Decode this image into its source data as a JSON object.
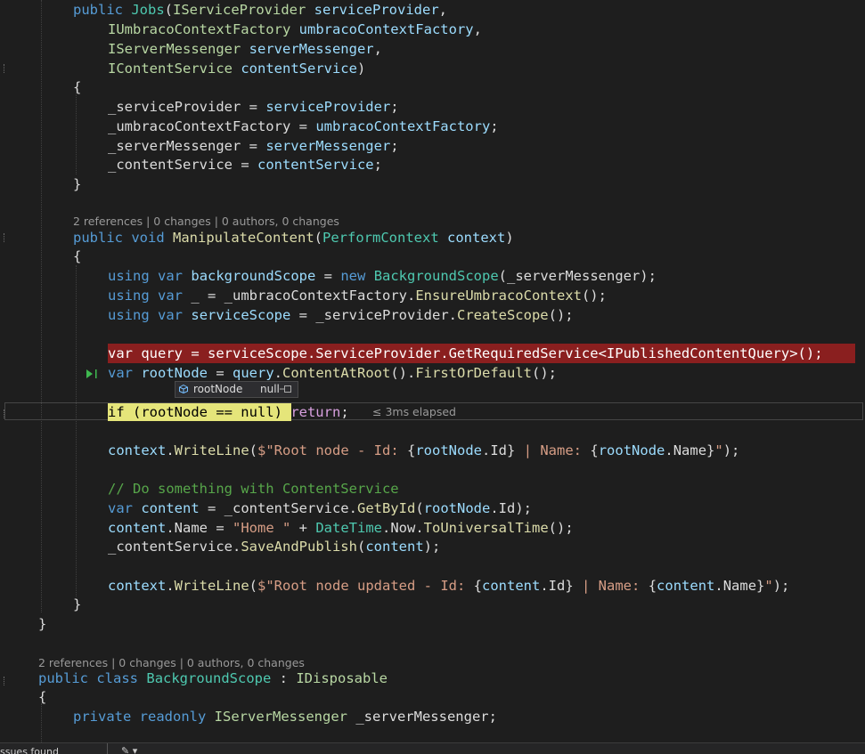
{
  "code": {
    "ctor_line_1": {
      "kw": "public",
      "name": "Jobs",
      "open": "(",
      "type": "IServiceProvider",
      "param": "serviceProvider",
      "end": ","
    },
    "ctor_line_2": {
      "type": "IUmbracoContextFactory",
      "param": "umbracoContextFactory",
      "end": ","
    },
    "ctor_line_3": {
      "type": "IServerMessenger",
      "param": "serverMessenger",
      "end": ","
    },
    "ctor_line_4": {
      "type": "IContentService",
      "param": "contentService",
      "end": ")"
    },
    "open_brace": "{",
    "close_brace": "}",
    "assign_1": {
      "field": "_serviceProvider",
      "op": " = ",
      "value": "serviceProvider",
      "end": ";"
    },
    "assign_2": {
      "field": "_umbracoContextFactory",
      "op": " = ",
      "value": "umbracoContextFactory",
      "end": ";"
    },
    "assign_3": {
      "field": "_serverMessenger",
      "op": " = ",
      "value": "serverMessenger",
      "end": ";"
    },
    "assign_4": {
      "field": "_contentService",
      "op": " = ",
      "value": "contentService",
      "end": ";"
    },
    "lens_manipulate": "2 references | 0 changes | 0 authors, 0 changes",
    "method_sig": {
      "kw1": "public",
      "kw2": "void",
      "name": "ManipulateContent",
      "open": "(",
      "type": "PerformContext",
      "param": "context",
      "close": ")"
    },
    "using_1": {
      "kw1": "using",
      "kw2": "var",
      "var": "backgroundScope",
      "eq": " = ",
      "new": "new",
      "type": "BackgroundScope",
      "args": "(_serverMessenger);"
    },
    "using_2": {
      "kw1": "using",
      "kw2": "var",
      "rest": "_ = _umbracoContextFactory.",
      "fn": "EnsureUmbracoContext",
      "end": "();"
    },
    "using_3": {
      "kw1": "using",
      "kw2": "var",
      "var": "serviceScope",
      "eq": " = _serviceProvider.",
      "fn": "CreateScope",
      "end": "();"
    },
    "query_line": "var query = serviceScope.ServiceProvider.GetRequiredService<IPublishedContentQuery>();",
    "rootnode_line": {
      "kw": "var",
      "var": "rootNode",
      "eq": " = ",
      "obj": "query",
      "dot1": ".",
      "fn1": "ContentAtRoot",
      "mid": "().",
      "fn2": "FirstOrDefault",
      "end": "();"
    },
    "datatip": {
      "name": "rootNode",
      "value": "null"
    },
    "if_line": {
      "stmt": "if (rootNode == null)",
      "ret": "return",
      "end": ";"
    },
    "elapsed": "≤ 3ms elapsed",
    "writeline_1": {
      "obj": "context",
      "dot": ".",
      "fn": "WriteLine",
      "open": "(",
      "s1": "$\"Root node - Id: ",
      "b1": "{",
      "v1": "rootNode",
      "d1": ".",
      "p1": "Id",
      "c1": "}",
      "s2": " | Name: ",
      "b2": "{",
      "v2": "rootNode",
      "d2": ".",
      "p2": "Name",
      "c2": "}",
      "s3": "\"",
      "end": ");"
    },
    "comment": "// Do something with ContentService",
    "content_1": {
      "kw": "var",
      "var": "content",
      "eq": " = _contentService.",
      "fn": "GetById",
      "open": "(",
      "arg": "rootNode",
      "dot": ".",
      "prop": "Id",
      "end": ");"
    },
    "content_2": {
      "var": "content",
      "dot": ".",
      "prop": "Name",
      "eq": " = ",
      "str": "\"Home \"",
      "plus": " + ",
      "type": "DateTime",
      "d1": ".",
      "now": "Now",
      "d2": ".",
      "fn": "ToUniversalTime",
      "end": "();"
    },
    "content_3": {
      "obj": "_contentService",
      "dot": ".",
      "fn": "SaveAndPublish",
      "open": "(",
      "arg": "content",
      "end": ");"
    },
    "writeline_2": {
      "obj": "context",
      "dot": ".",
      "fn": "WriteLine",
      "open": "(",
      "s1": "$\"Root node updated - Id: ",
      "b1": "{",
      "v1": "content",
      "d1": ".",
      "p1": "Id",
      "c1": "}",
      "s2": " | Name: ",
      "b2": "{",
      "v2": "content",
      "d2": ".",
      "p2": "Name",
      "c2": "}",
      "s3": "\"",
      "end": ");"
    },
    "lens_background": "2 references | 0 changes | 0 authors, 0 changes",
    "class_decl": {
      "kw1": "public",
      "kw2": "class",
      "name": "BackgroundScope",
      "colon": " : ",
      "iface": "IDisposable"
    },
    "field_decl": {
      "kw1": "private",
      "kw2": "readonly",
      "type": "IServerMessenger",
      "name": " _serverMessenger;"
    }
  },
  "status": {
    "issues": "ssues found"
  },
  "colors": {
    "background": "#1e1e1e",
    "keyword": "#569cd6",
    "type": "#4ec9b0",
    "interface": "#b8d7a3",
    "method": "#dcdcaa",
    "variable": "#9cdcfe",
    "string": "#d69d85",
    "comment": "#57a64a",
    "breakpoint_line": "#8a1f1f",
    "current_statement": "#e5e57a"
  }
}
